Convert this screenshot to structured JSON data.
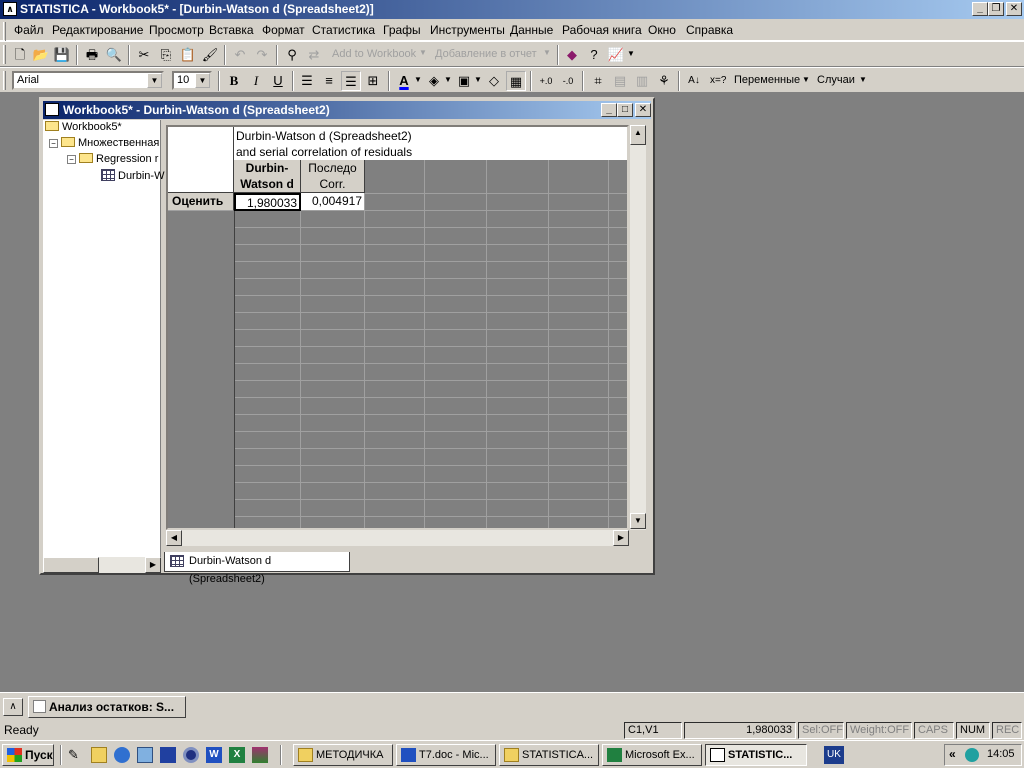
{
  "app": {
    "title": "STATISTICA - Workbook5* - [Durbin-Watson d (Spreadsheet2)]",
    "controls": {
      "minimize": "_",
      "restore": "❐",
      "close": "✕"
    }
  },
  "menu": [
    "Файл",
    "Редактирование",
    "Просмотр",
    "Вставка",
    "Формат",
    "Статистика",
    "Графы",
    "Инструменты",
    "Данные",
    "Рабочая книга",
    "Окно",
    "Справка"
  ],
  "toolbar": {
    "add_to_workbook": "Add to Workbook",
    "add_to_report": "Добавление в отчет",
    "font_name": "Arial",
    "font_size": "10",
    "bold": "B",
    "italic": "I",
    "underline": "U",
    "variables": "Переменные",
    "cases": "Случаи",
    "xeq": "x=?"
  },
  "workbook": {
    "title": "Workbook5* - Durbin-Watson d (Spreadsheet2)",
    "tree": {
      "root": "Workbook5*",
      "level1": "Множественная",
      "level2": "Regression r",
      "level3": "Durbin-W"
    },
    "tab_label": "Durbin-Watson d (Spreadsheet2)"
  },
  "spreadsheet": {
    "title_line1": "Durbin-Watson d (Spreadsheet2)",
    "title_line2": "and serial correlation of residuals",
    "columns": [
      {
        "line1": "Durbin-",
        "line2": "Watson d"
      },
      {
        "line1": "Последо",
        "line2": "Corr."
      }
    ],
    "rows": [
      {
        "label": "Оценить",
        "values": [
          "1,980033",
          "0,004917"
        ]
      }
    ]
  },
  "minimized_window": "Анализ остатков: S...",
  "status": {
    "ready": "Ready",
    "cell_ref": "C1,V1",
    "cell_value": "1,980033",
    "sel": "Sel:OFF",
    "weight": "Weight:OFF",
    "caps": "CAPS",
    "num": "NUM",
    "rec": "REC"
  },
  "taskbar": {
    "start": "Пуск",
    "buttons": [
      "МЕТОДИЧКА",
      "T7.doc - Mic...",
      "STATISTICA...",
      "Microsoft Ex...",
      "STATISTIC..."
    ],
    "lang": "UK",
    "clock": "14:05"
  }
}
